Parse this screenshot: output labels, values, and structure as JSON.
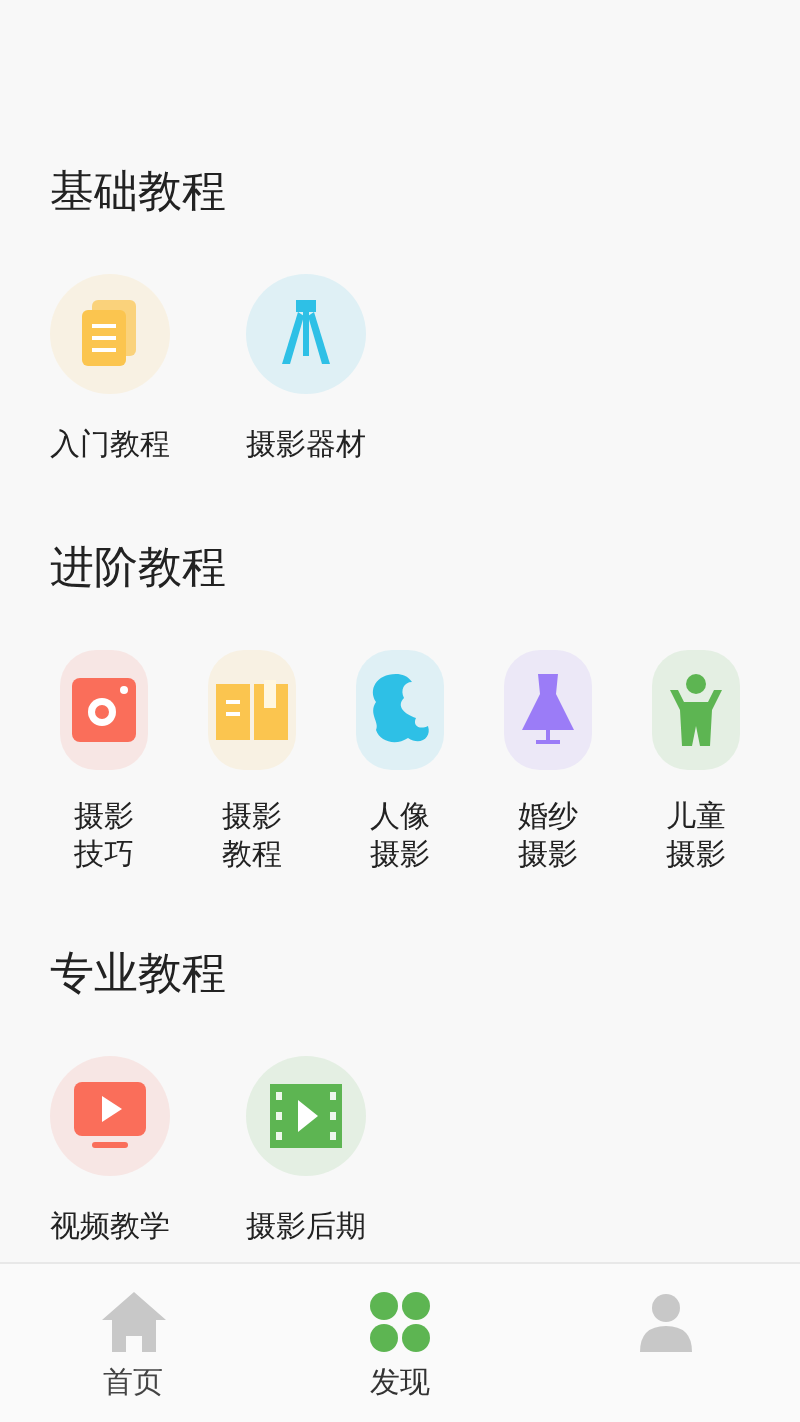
{
  "sections": [
    {
      "title": "基础教程",
      "items": [
        {
          "label": "入门教程",
          "color": "#fbc54f"
        },
        {
          "label": "摄影器材",
          "color": "#2ec0e6"
        }
      ]
    },
    {
      "title": "进阶教程",
      "items": [
        {
          "label": "摄影技巧",
          "color": "#fa6e5a"
        },
        {
          "label": "摄影教程",
          "color": "#fbc54f"
        },
        {
          "label": "人像摄影",
          "color": "#2ec0e6"
        },
        {
          "label": "婚纱摄影",
          "color": "#9b7cf7"
        },
        {
          "label": "儿童摄影",
          "color": "#5db552"
        }
      ]
    },
    {
      "title": "专业教程",
      "items": [
        {
          "label": "视频教学",
          "color": "#fa6e5a"
        },
        {
          "label": "摄影后期",
          "color": "#5db552"
        }
      ]
    }
  ],
  "bottom_nav": [
    {
      "label": "首页",
      "selected": false
    },
    {
      "label": "发现",
      "selected": true
    },
    {
      "selected": false
    }
  ]
}
